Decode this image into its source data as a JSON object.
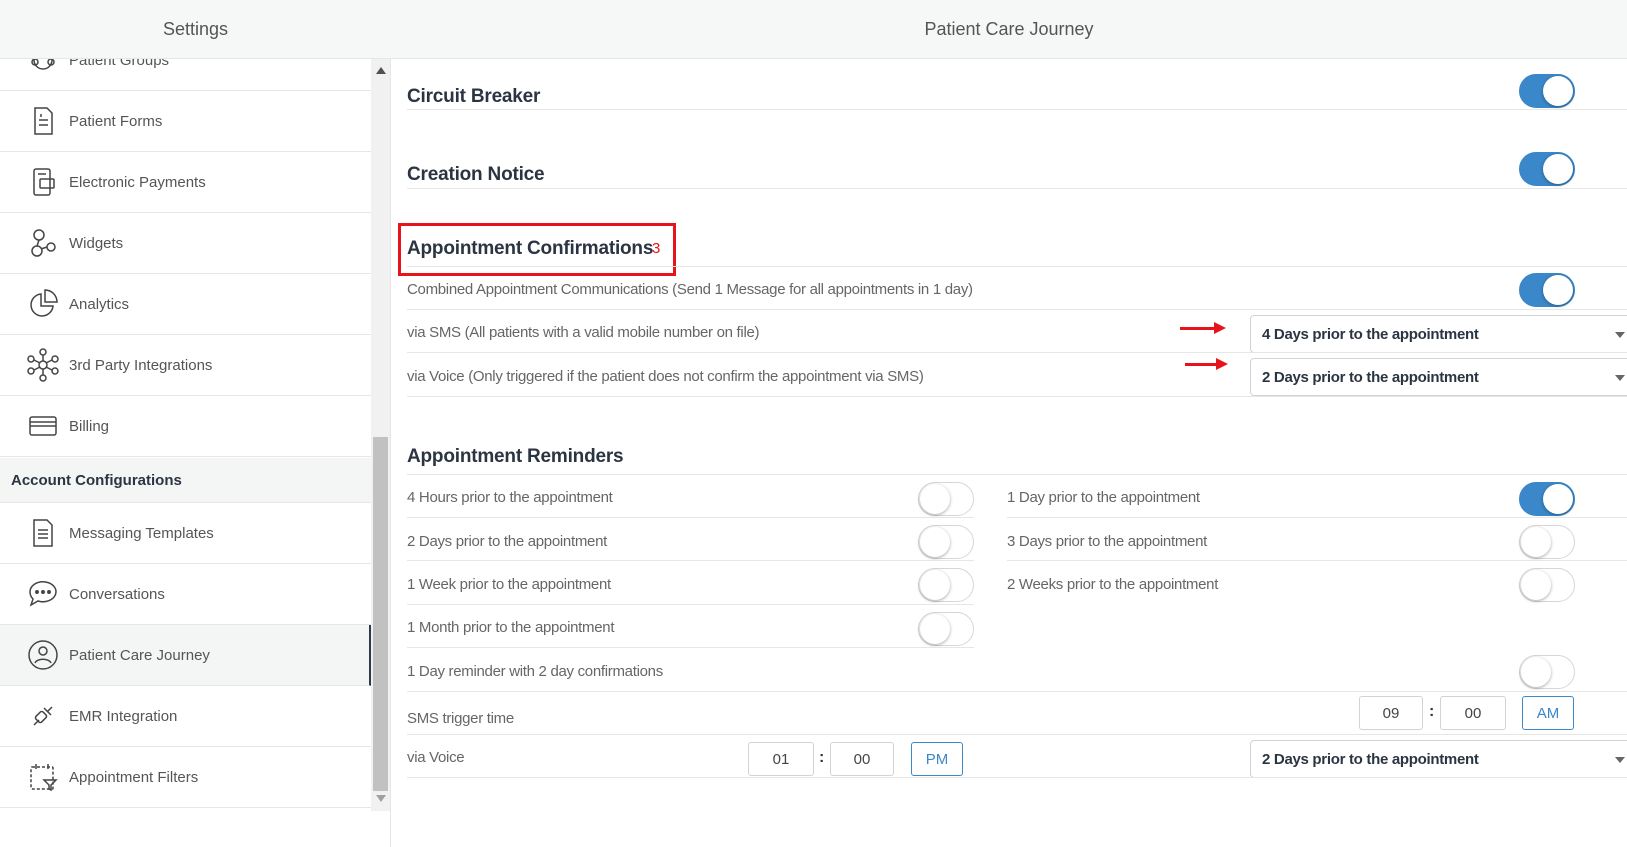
{
  "sidebar": {
    "title": "Settings",
    "items_top": [
      {
        "label": "Patient Groups",
        "icon": "patient-groups-icon"
      },
      {
        "label": "Patient Forms",
        "icon": "patient-forms-icon"
      },
      {
        "label": "Electronic Payments",
        "icon": "electronic-payments-icon"
      },
      {
        "label": "Widgets",
        "icon": "widgets-icon"
      },
      {
        "label": "Analytics",
        "icon": "analytics-icon"
      },
      {
        "label": "3rd Party Integrations",
        "icon": "integrations-icon"
      },
      {
        "label": "Billing",
        "icon": "billing-icon"
      }
    ],
    "section_label": "Account Configurations",
    "items_bottom": [
      {
        "label": "Messaging Templates",
        "icon": "messaging-templates-icon"
      },
      {
        "label": "Conversations",
        "icon": "conversations-icon"
      },
      {
        "label": "Patient Care Journey",
        "icon": "patient-care-journey-icon",
        "active": true
      },
      {
        "label": "EMR Integration",
        "icon": "emr-integration-icon"
      },
      {
        "label": "Appointment Filters",
        "icon": "appointment-filters-icon"
      }
    ]
  },
  "main": {
    "title": "Patient Care Journey",
    "circuit_breaker": {
      "title": "Circuit Breaker",
      "enabled": true
    },
    "creation_notice": {
      "title": "Creation Notice",
      "enabled": true
    },
    "confirmations": {
      "title": "Appointment Confirmations",
      "badge": "3",
      "combined_label": "Combined Appointment Communications (Send 1 Message for all appointments in 1 day)",
      "combined_enabled": true,
      "sms_label": "via SMS (All patients with a valid mobile number on file)",
      "sms_value": "4 Days prior to the appointment",
      "voice_label": "via Voice (Only triggered if the patient does not confirm the appointment via SMS)",
      "voice_value": "2 Days prior to the appointment"
    },
    "reminders": {
      "title": "Appointment Reminders",
      "left": [
        {
          "label": "4 Hours prior to the appointment",
          "enabled": false
        },
        {
          "label": "2 Days prior to the appointment",
          "enabled": false
        },
        {
          "label": "1 Week prior to the appointment",
          "enabled": false
        },
        {
          "label": "1 Month prior to the appointment",
          "enabled": false
        }
      ],
      "right": [
        {
          "label": "1 Day prior to the appointment",
          "enabled": true
        },
        {
          "label": "3 Days prior to the appointment",
          "enabled": false
        },
        {
          "label": "2 Weeks prior to the appointment",
          "enabled": false
        }
      ],
      "combo_label": "1 Day reminder with 2 day confirmations",
      "combo_enabled": false,
      "sms_trigger": {
        "label": "SMS trigger time",
        "hour": "09",
        "minute": "00",
        "ampm": "AM"
      },
      "voice": {
        "label": "via Voice",
        "hour": "01",
        "minute": "00",
        "ampm": "PM",
        "value": "2 Days prior to the appointment"
      }
    }
  },
  "colors": {
    "accent": "#3a87c9",
    "annotation": "#e8141b",
    "heading": "#2b3542"
  }
}
